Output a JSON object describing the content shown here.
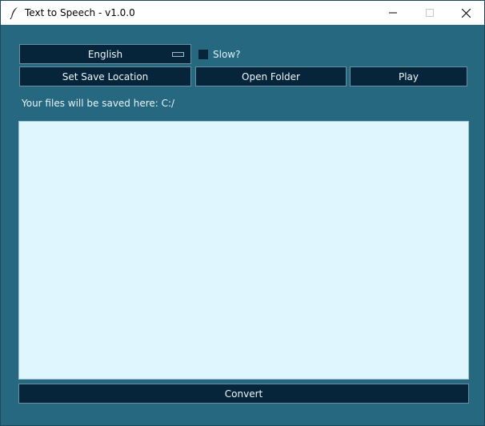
{
  "window": {
    "title": "Text to Speech - v1.0.0"
  },
  "controls": {
    "language_value": "English",
    "slow_label": "Slow?",
    "slow_checked": false,
    "set_save_label": "Set Save Location",
    "open_folder_label": "Open Folder",
    "play_label": "Play",
    "save_location_text": "Your files will be saved here: C:/",
    "text_input_value": "",
    "convert_label": "Convert"
  },
  "icons": {
    "app": "feather-icon",
    "minimize": "minimize-icon",
    "maximize": "maximize-icon",
    "close": "close-icon",
    "dropdown": "dropdown-arrow-icon"
  },
  "colors": {
    "background": "#26687f",
    "button": "#06243a",
    "text_area": "#dff6ff",
    "button_text": "#eef6fb"
  }
}
